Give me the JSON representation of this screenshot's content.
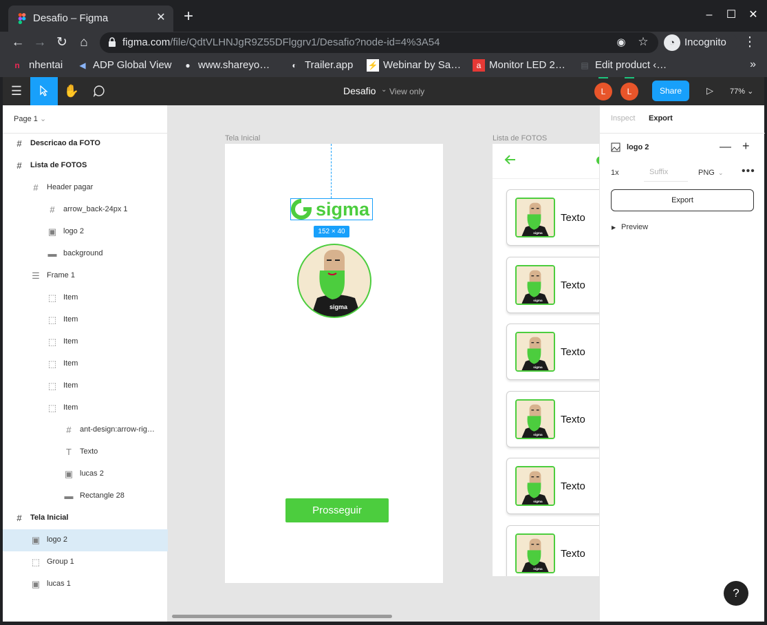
{
  "browser": {
    "tab_title": "Desafio – Figma",
    "tab_close": "✕",
    "new_tab": "+",
    "window_controls": {
      "minimize": "–",
      "maximize": "☐",
      "close": "✕"
    },
    "url_host": "figma.com",
    "url_path": "/file/QdtVLHNJgR9Z55DFlggrv1/Desafio?node-id=4%3A54",
    "incognito_label": "Incognito",
    "menu": "⋮"
  },
  "bookmarks": [
    {
      "label": "nhentai",
      "icon": "n-icon",
      "color": "#ec2854"
    },
    {
      "label": "ADP Global View",
      "icon": "adp-icon",
      "color": "#8ab4f8"
    },
    {
      "label": "www.shareyo…",
      "icon": "globe-icon",
      "color": "#e8eaed"
    },
    {
      "label": "Trailer.app",
      "icon": "trailer-icon",
      "color": "#e8eaed"
    },
    {
      "label": "Webinar by Sa…",
      "icon": "webinar-icon",
      "color": "#e53935"
    },
    {
      "label": "Monitor LED 2…",
      "icon": "amazon-icon",
      "color": "#e53935"
    },
    {
      "label": "Edit product ‹…",
      "icon": "edit-icon",
      "color": "#5f6368"
    }
  ],
  "bookmarks_more": "»",
  "figma": {
    "file_name": "Desafio",
    "view_only": "View only",
    "avatar_1": "L",
    "avatar_2": "L",
    "share": "Share",
    "zoom": "77%",
    "accent": "#18a0fb"
  },
  "layers": {
    "page": "Page 1",
    "items": [
      {
        "label": "Descricao da FOTO",
        "icon": "frame-icon",
        "indent": 0,
        "bold": true
      },
      {
        "label": "Lista de FOTOS",
        "icon": "frame-icon",
        "indent": 0,
        "bold": true
      },
      {
        "label": "Header pagar",
        "icon": "frame-icon",
        "indent": 1
      },
      {
        "label": "arrow_back-24px 1",
        "icon": "frame-icon",
        "indent": 2
      },
      {
        "label": "logo 2",
        "icon": "image-icon",
        "indent": 2
      },
      {
        "label": "background",
        "icon": "rectangle-icon",
        "indent": 2
      },
      {
        "label": "Frame 1",
        "icon": "auto-layout-icon",
        "indent": 1
      },
      {
        "label": "Item",
        "icon": "group-icon",
        "indent": 2
      },
      {
        "label": "Item",
        "icon": "group-icon",
        "indent": 2
      },
      {
        "label": "Item",
        "icon": "group-icon",
        "indent": 2
      },
      {
        "label": "Item",
        "icon": "group-icon",
        "indent": 2
      },
      {
        "label": "Item",
        "icon": "group-icon",
        "indent": 2
      },
      {
        "label": "Item",
        "icon": "group-icon",
        "indent": 2
      },
      {
        "label": "ant-design:arrow-rig…",
        "icon": "frame-icon",
        "indent": 3
      },
      {
        "label": "Texto",
        "icon": "text-icon",
        "indent": 3
      },
      {
        "label": "lucas 2",
        "icon": "image-icon",
        "indent": 3
      },
      {
        "label": "Rectangle 28",
        "icon": "rectangle-icon",
        "indent": 3
      },
      {
        "label": "Tela Inicial",
        "icon": "frame-icon",
        "indent": 0,
        "bold": true
      },
      {
        "label": "logo 2",
        "icon": "image-icon",
        "indent": 1,
        "selected": true
      },
      {
        "label": "Group 1",
        "icon": "group-icon",
        "indent": 1
      },
      {
        "label": "lucas 1",
        "icon": "image-icon",
        "indent": 1
      }
    ]
  },
  "canvas": {
    "frame1_label": "Tela Inicial",
    "frame2_label": "Lista de FOTOS",
    "logo_text": "sigma",
    "avatar_logo_text": "sigma",
    "dimensions": "152 × 40",
    "cta": "Prosseguir",
    "card_label": "Texto",
    "card_count": 6,
    "brand_green": "#4ccd3e"
  },
  "inspector": {
    "tab_inspect": "Inspect",
    "tab_export": "Export",
    "layer_name": "logo 2",
    "scale": "1x",
    "suffix_placeholder": "Suffix",
    "format": "PNG",
    "export_button": "Export",
    "preview": "Preview",
    "help": "?"
  }
}
